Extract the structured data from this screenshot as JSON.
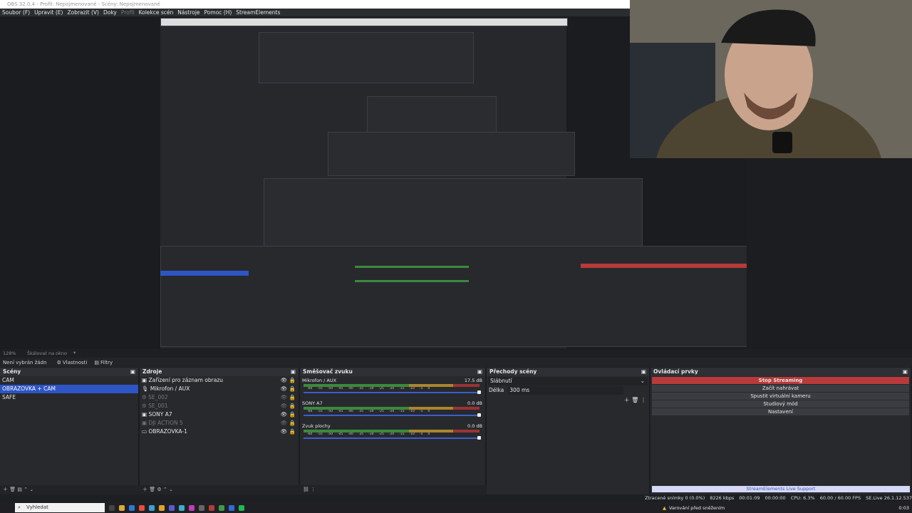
{
  "window": {
    "title": "OBS 32.0.4 - Profil: Nepojmenované - Scény: Nepojmenované"
  },
  "menu": [
    {
      "label": "Soubor (F)"
    },
    {
      "label": "Upravit (E)"
    },
    {
      "label": "Zobrazit (V)"
    },
    {
      "label": "Doky"
    },
    {
      "label": "Profil",
      "dim": true
    },
    {
      "label": "Kolekce scén"
    },
    {
      "label": "Nástroje"
    },
    {
      "label": "Pomoc (H)"
    },
    {
      "label": "StreamElements"
    }
  ],
  "canvas": {
    "zoom": "128%",
    "scale_label": "Škálovat na okno"
  },
  "scene_bar": {
    "no_selection": "Není vybrán žádn",
    "properties": "Vlastnosti",
    "filters": "Filtry"
  },
  "scenes": {
    "title": "Scény",
    "items": [
      {
        "label": "CAM"
      },
      {
        "label": "OBRAZOVKA + CAM",
        "selected": true
      },
      {
        "label": "SAFE"
      }
    ]
  },
  "sources": {
    "title": "Zdroje",
    "items": [
      {
        "label": "Zařízení pro záznam obrazu",
        "hidden": false
      },
      {
        "label": "Mikrofon / AUX",
        "hidden": false
      },
      {
        "label": "SE_002",
        "hidden": true
      },
      {
        "label": "SE_001",
        "hidden": true
      },
      {
        "label": "SONY A7",
        "hidden": false
      },
      {
        "label": "DJI ACTION 5",
        "hidden": true
      },
      {
        "label": "OBRAZOVKA-1",
        "hidden": false
      }
    ]
  },
  "mixer": {
    "title": "Směšovač zvuku",
    "channels": [
      {
        "name": "Mikrofon / AUX",
        "db": "17.5 dB"
      },
      {
        "name": "SONY A7",
        "db": "0.0 dB"
      },
      {
        "name": "Zvuk plochy",
        "db": "0.0 dB"
      }
    ],
    "ticks": [
      "-60",
      "-55",
      "-50",
      "-45",
      "-40",
      "-35",
      "-30",
      "-25",
      "-20",
      "-15",
      "-10",
      "-5",
      "0"
    ]
  },
  "transitions": {
    "title": "Přechody scény",
    "type": "Slábnutí",
    "duration_label": "Délka",
    "duration": "300 ms"
  },
  "controls": {
    "title": "Ovládací prvky",
    "buttons": [
      {
        "label": "Stop Streaming",
        "active": true
      },
      {
        "label": "Začít nahrávat"
      },
      {
        "label": "Spustit virtuální kameru"
      },
      {
        "label": "Studiový mód"
      },
      {
        "label": "Nastavení"
      }
    ],
    "support": "StreamElements Live Support"
  },
  "status": {
    "dropped": "Ztracené snímky 0 (0.0%)",
    "bitrate": "8226 kbps",
    "stream_time": "00:01:09",
    "rec_time": "00:00:00",
    "cpu": "CPU: 6.3%",
    "fps": "60.00 / 60.00 FPS",
    "se_version": "SE.Live 26.1.12.537"
  },
  "taskbar": {
    "search_placeholder": "Vyhledat",
    "warning": "Varování před sněžením",
    "clock": "0:03"
  },
  "colors": {
    "accent": "#2d55c4",
    "stop": "#b83a3a",
    "meter_green": "#3b8a3b",
    "meter_yellow": "#a8872d",
    "meter_red": "#9a3333"
  }
}
